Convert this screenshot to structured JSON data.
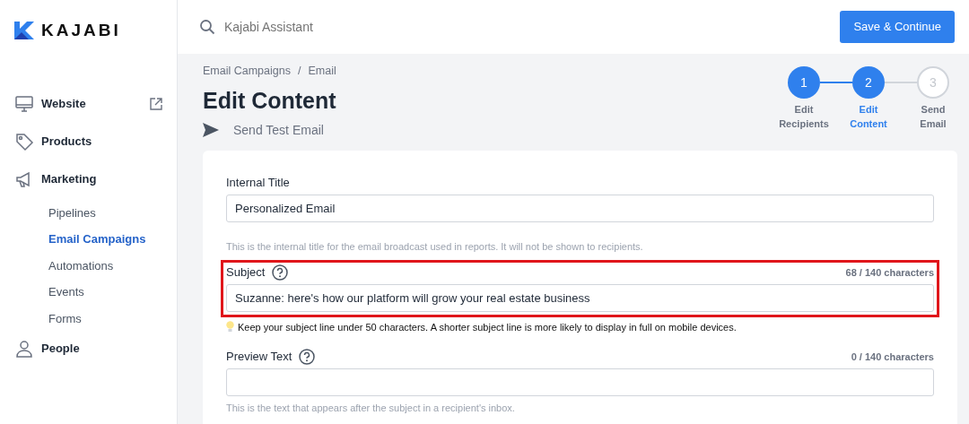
{
  "brand": {
    "name": "KAJABI"
  },
  "sidebar": {
    "items": [
      {
        "label": "Website",
        "external": true
      },
      {
        "label": "Products",
        "external": false
      },
      {
        "label": "Marketing",
        "external": false,
        "children": [
          {
            "label": "Pipelines",
            "selected": false
          },
          {
            "label": "Email Campaigns",
            "selected": true
          },
          {
            "label": "Automations",
            "selected": false
          },
          {
            "label": "Events",
            "selected": false
          },
          {
            "label": "Forms",
            "selected": false
          }
        ]
      },
      {
        "label": "People",
        "external": false
      }
    ]
  },
  "search": {
    "placeholder": "Kajabi Assistant"
  },
  "save_button": "Save & Continue",
  "breadcrumb": {
    "items": [
      "Email Campaigns",
      "Email"
    ],
    "separator": "/"
  },
  "title": "Edit Content",
  "send_test": "Send Test Email",
  "steps": [
    {
      "number": "1",
      "label": "Edit Recipients",
      "kind": "done"
    },
    {
      "number": "2",
      "label": "Edit Content",
      "kind": "current"
    },
    {
      "number": "3",
      "label": "Send Email",
      "kind": "todo"
    }
  ],
  "fields": [
    {
      "label": "Internal Title",
      "help": false,
      "value": "Personalized Email",
      "highlighted": false,
      "hint": "This is the internal title for the email broadcast used in reports. It will not be shown to recipients.",
      "tip": false
    },
    {
      "label": "Subject",
      "help": true,
      "counter": "68 / 140 characters",
      "value": "Suzanne: here's how our platform will grow your real estate business",
      "highlighted": true,
      "hint": "Keep your subject line under 50 characters. A shorter subject line is more likely to display in full on mobile devices.",
      "tip": true
    },
    {
      "label": "Preview Text",
      "help": true,
      "counter": "0 / 140 characters",
      "highlighted": false,
      "hint": "This is the text that appears after the subject in a recipient's inbox.",
      "tip": false
    }
  ]
}
